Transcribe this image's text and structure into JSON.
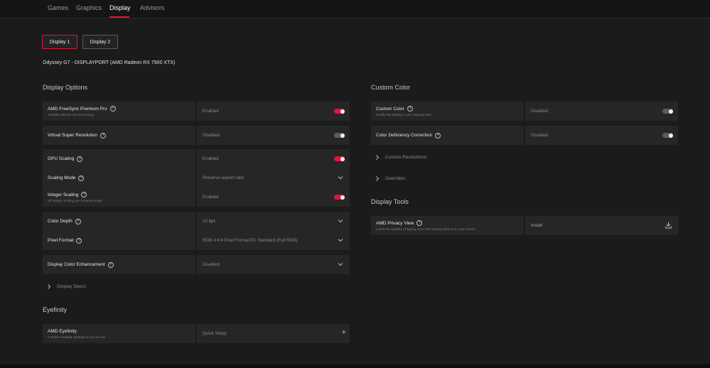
{
  "tabs": [
    {
      "label": "Games"
    },
    {
      "label": "Graphics"
    },
    {
      "label": "Display"
    },
    {
      "label": "Advisors"
    }
  ],
  "displays": [
    {
      "label": "Display 1"
    },
    {
      "label": "Display 2"
    }
  ],
  "monitor_name": "Odyssey G7 - DISPLAYPORT (AMD Radeon RX 7900 XTX)",
  "display_options": {
    "title": "Display Options",
    "freesync": {
      "label": "AMD FreeSync Premium Pro",
      "sub": "Variable-refresh-rate technology",
      "value": "Enabled",
      "state": "on"
    },
    "vsr": {
      "label": "Virtual Super Resolution",
      "value": "Disabled",
      "state": "off"
    },
    "gpu_scaling": {
      "label": "GPU Scaling",
      "value": "Enabled",
      "state": "on"
    },
    "scaling_mode": {
      "label": "Scaling Mode",
      "value": "Preserve aspect ratio"
    },
    "integer_scaling": {
      "label": "Integer Scaling",
      "sub": "All Integer Scaling are centered mode",
      "value": "Enabled",
      "state": "on"
    },
    "color_depth": {
      "label": "Color Depth",
      "value": "10 bpc"
    },
    "pixel_format": {
      "label": "Pixel Format",
      "value": "RGB 4:4:4 Pixel Format PC Standard (Full RGB)"
    },
    "color_enhancement": {
      "label": "Display Color Enhancement",
      "value": "Disabled"
    },
    "specs": {
      "label": "Display Specs"
    }
  },
  "eyefinity": {
    "title": "Eyefinity",
    "label": "AMD Eyefinity",
    "sub": "Combine multiple displays to act as one",
    "value": "Quick Setup"
  },
  "custom_color": {
    "title": "Custom Color",
    "custom": {
      "label": "Custom Color",
      "sub": "Modify the display's color reproduction",
      "value": "Disabled",
      "state": "off"
    },
    "deficiency": {
      "label": "Color Deficiency Correction",
      "value": "Disabled",
      "state": "off"
    },
    "resolutions": {
      "label": "Custom Resolutions"
    },
    "overrides": {
      "label": "Overrides"
    }
  },
  "display_tools": {
    "title": "Display Tools",
    "privacy": {
      "label": "AMD Privacy View",
      "sub": "Limits the visibility of spying eyes from seeing what is on your screen",
      "value": "Install"
    }
  },
  "help_glyph": "?",
  "plus_glyph": "+",
  "icons": [
    "help-icon",
    "chevron-down-icon",
    "chevron-right-icon",
    "plus-icon",
    "download-icon"
  ],
  "colors": {
    "accent": "#e0143c",
    "background": "#1b1b1b",
    "panel": "#262626"
  }
}
